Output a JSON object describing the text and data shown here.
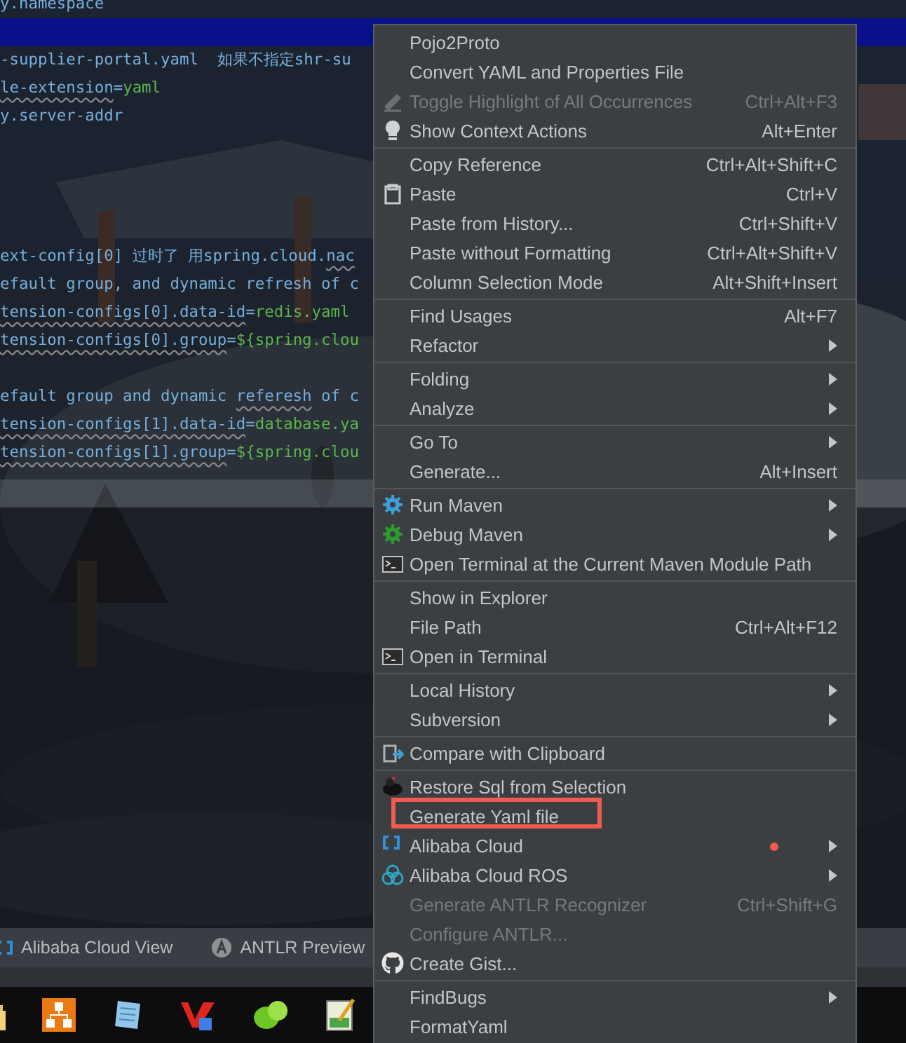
{
  "editor": {
    "lines": [
      {
        "kind": "code",
        "segments": [
          {
            "text": "y.namespace",
            "kind": "key"
          }
        ]
      },
      {
        "kind": "highlighted"
      },
      {
        "kind": "code",
        "segments": [
          {
            "text": "-supplier-portal.yaml  如果不指定shr-su",
            "kind": "key"
          }
        ]
      },
      {
        "kind": "code",
        "segments": [
          {
            "text": "le-extension",
            "kind": "key",
            "squiggle": true
          },
          {
            "text": "=",
            "kind": "key"
          },
          {
            "text": "yaml",
            "kind": "value"
          }
        ]
      },
      {
        "kind": "code",
        "segments": [
          {
            "text": "y.server-addr",
            "kind": "key"
          }
        ]
      },
      {
        "kind": "blank"
      },
      {
        "kind": "blank"
      },
      {
        "kind": "blank"
      },
      {
        "kind": "blank"
      },
      {
        "kind": "code",
        "segments": [
          {
            "text": "ext-config[0] 过时了 用spring.cloud.",
            "kind": "key"
          },
          {
            "text": "nac",
            "kind": "key",
            "squiggle": true
          }
        ]
      },
      {
        "kind": "code",
        "segments": [
          {
            "text": "efault group, and dynamic refresh of c",
            "kind": "key"
          }
        ]
      },
      {
        "kind": "code",
        "segments": [
          {
            "text": "tension-configs[0].data-id",
            "kind": "key",
            "squiggle": true
          },
          {
            "text": "=",
            "kind": "key"
          },
          {
            "text": "redis.yaml",
            "kind": "value"
          }
        ]
      },
      {
        "kind": "code",
        "segments": [
          {
            "text": "tension-configs[0].group",
            "kind": "key",
            "squiggle": true
          },
          {
            "text": "=",
            "kind": "key"
          },
          {
            "text": "${spring.clou",
            "kind": "value"
          }
        ]
      },
      {
        "kind": "blank"
      },
      {
        "kind": "code",
        "segments": [
          {
            "text": "efault group and dynamic ",
            "kind": "key"
          },
          {
            "text": "referesh",
            "kind": "key",
            "squiggle": true
          },
          {
            "text": " of c",
            "kind": "key"
          }
        ]
      },
      {
        "kind": "code",
        "segments": [
          {
            "text": "tension-configs[1].data-id",
            "kind": "key",
            "squiggle": true
          },
          {
            "text": "=",
            "kind": "key"
          },
          {
            "text": "database.ya",
            "kind": "value"
          }
        ]
      },
      {
        "kind": "code",
        "segments": [
          {
            "text": "tension-configs[1].group",
            "kind": "key",
            "squiggle": true
          },
          {
            "text": "=",
            "kind": "key"
          },
          {
            "text": "${spring.clou",
            "kind": "value"
          }
        ]
      }
    ]
  },
  "context_menu": {
    "groups": [
      {
        "items": [
          {
            "label": "Pojo2Proto",
            "submenu": false,
            "disabled": false
          },
          {
            "label": "Convert YAML and Properties File",
            "submenu": false,
            "disabled": false
          },
          {
            "label": "Toggle Highlight of All Occurrences",
            "shortcut": "Ctrl+Alt+F3",
            "kind": "pencil",
            "submenu": false,
            "disabled": true
          },
          {
            "label": "Show Context Actions",
            "shortcut": "Alt+Enter",
            "kind": "bulb",
            "submenu": false,
            "disabled": false
          }
        ]
      },
      {
        "items": [
          {
            "label": "Copy Reference",
            "shortcut": "Ctrl+Alt+Shift+C",
            "submenu": false,
            "disabled": false
          },
          {
            "label": "Paste",
            "shortcut": "Ctrl+V",
            "kind": "clipboard",
            "submenu": false,
            "disabled": false
          },
          {
            "label": "Paste from History...",
            "shortcut": "Ctrl+Shift+V",
            "submenu": false,
            "disabled": false
          },
          {
            "label": "Paste without Formatting",
            "shortcut": "Ctrl+Alt+Shift+V",
            "submenu": false,
            "disabled": false
          },
          {
            "label": "Column Selection Mode",
            "shortcut": "Alt+Shift+Insert",
            "submenu": false,
            "disabled": false
          }
        ]
      },
      {
        "items": [
          {
            "label": "Find Usages",
            "shortcut": "Alt+F7",
            "submenu": false,
            "disabled": false
          },
          {
            "label": "Refactor",
            "submenu": true,
            "disabled": false
          }
        ]
      },
      {
        "items": [
          {
            "label": "Folding",
            "submenu": true,
            "disabled": false
          },
          {
            "label": "Analyze",
            "submenu": true,
            "disabled": false
          }
        ]
      },
      {
        "items": [
          {
            "label": "Go To",
            "submenu": true,
            "disabled": false
          },
          {
            "label": "Generate...",
            "shortcut": "Alt+Insert",
            "submenu": false,
            "disabled": false
          }
        ]
      },
      {
        "items": [
          {
            "label": "Run Maven",
            "kind": "gear",
            "color": "#3d9fd6",
            "submenu": true,
            "disabled": false
          },
          {
            "label": "Debug Maven",
            "kind": "gear",
            "color": "#2e9b2e",
            "submenu": true,
            "disabled": false
          },
          {
            "label": "Open Terminal at the Current Maven Module Path",
            "kind": "terminal",
            "submenu": false,
            "disabled": false
          }
        ]
      },
      {
        "items": [
          {
            "label": "Show in Explorer",
            "submenu": false,
            "disabled": false
          },
          {
            "label": "File Path",
            "shortcut": "Ctrl+Alt+F12",
            "submenu": false,
            "disabled": false
          },
          {
            "label": "Open in Terminal",
            "kind": "terminal",
            "submenu": false,
            "disabled": false
          }
        ]
      },
      {
        "items": [
          {
            "label": "Local History",
            "submenu": true,
            "disabled": false
          },
          {
            "label": "Subversion",
            "submenu": true,
            "disabled": false
          }
        ]
      },
      {
        "items": [
          {
            "label": "Compare with Clipboard",
            "kind": "compare",
            "submenu": false,
            "disabled": false
          }
        ]
      },
      {
        "items": [
          {
            "label": "Restore Sql from Selection",
            "kind": "bird",
            "submenu": false,
            "disabled": false
          },
          {
            "label": "Generate Yaml file",
            "submenu": false,
            "disabled": false,
            "annotated": true
          },
          {
            "label": "Alibaba Cloud",
            "kind": "brackets",
            "submenu": true,
            "disabled": false,
            "dot": true
          },
          {
            "label": "Alibaba Cloud ROS",
            "kind": "rings",
            "submenu": true,
            "disabled": false
          },
          {
            "label": "Generate ANTLR Recognizer",
            "shortcut": "Ctrl+Shift+G",
            "submenu": false,
            "disabled": true
          },
          {
            "label": "Configure ANTLR...",
            "submenu": false,
            "disabled": true
          },
          {
            "label": "Create Gist...",
            "kind": "cat",
            "submenu": false,
            "disabled": false
          }
        ]
      },
      {
        "items": [
          {
            "label": "FindBugs",
            "submenu": true,
            "disabled": false
          },
          {
            "label": "FormatYaml",
            "submenu": false,
            "disabled": false
          }
        ]
      }
    ]
  },
  "tool_windows": [
    {
      "label": "Alibaba Cloud View",
      "kind": "brackets"
    },
    {
      "label": "ANTLR Preview",
      "kind": "letter"
    }
  ],
  "taskbar": [
    {
      "kind": "folder"
    },
    {
      "kind": "network"
    },
    {
      "kind": "notepad"
    },
    {
      "kind": "redmark"
    },
    {
      "kind": "leaf"
    },
    {
      "kind": "editor"
    }
  ]
}
